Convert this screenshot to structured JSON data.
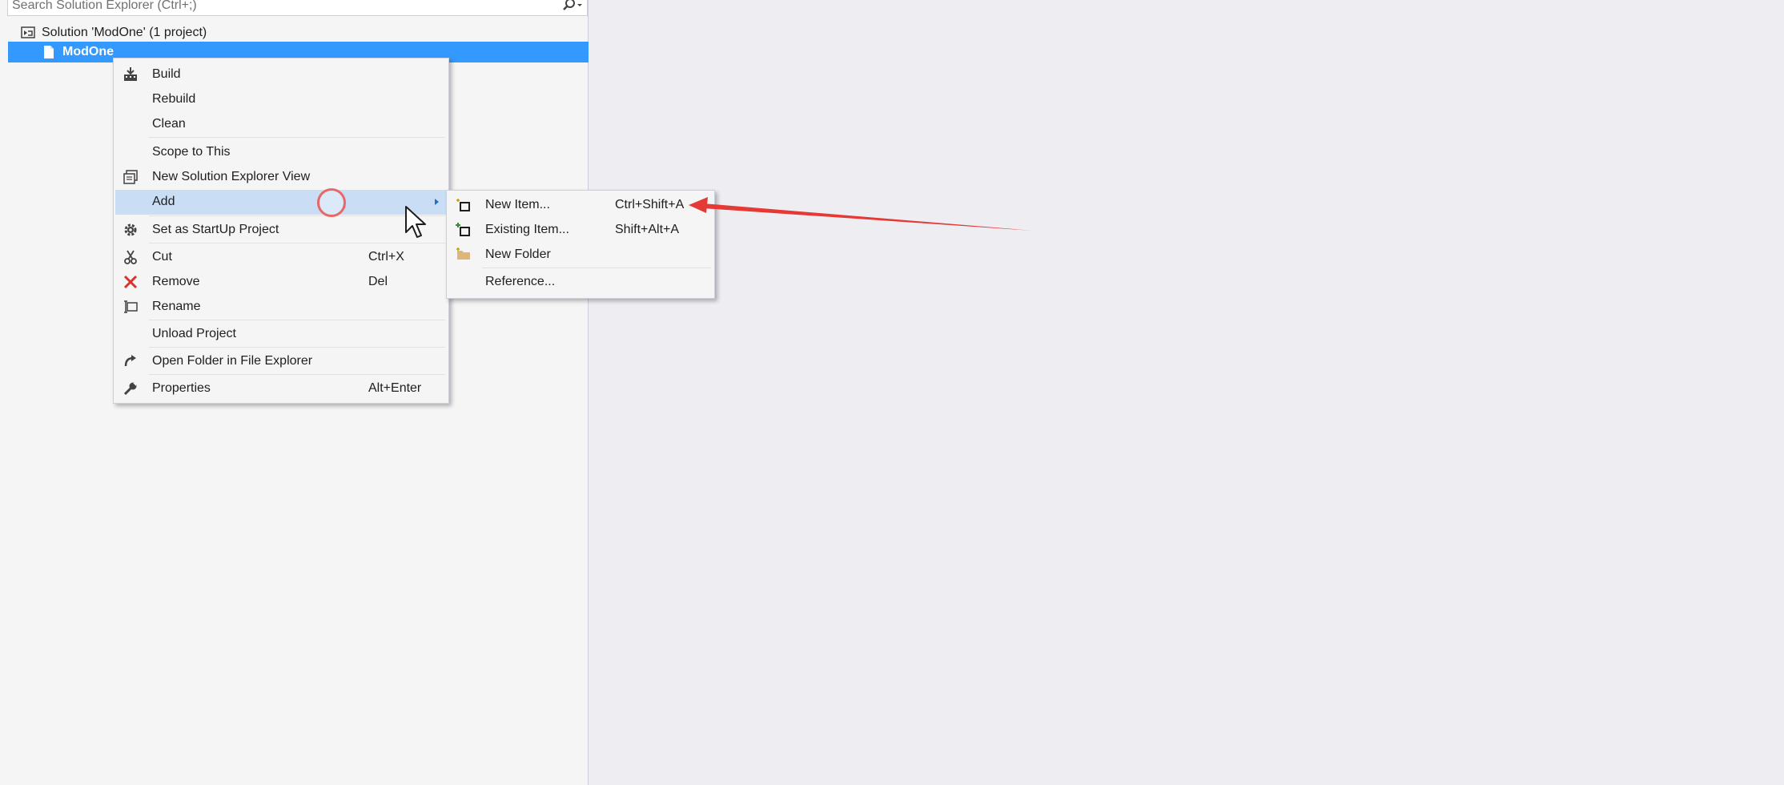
{
  "search": {
    "placeholder": "Search Solution Explorer (Ctrl+;)",
    "icon": "search-icon"
  },
  "tree": {
    "solution_label": "Solution 'ModOne' (1 project)",
    "project_label": "ModOne"
  },
  "context_menu": {
    "items": [
      {
        "label": "Build",
        "shortcut": "",
        "icon": "build-icon"
      },
      {
        "label": "Rebuild",
        "shortcut": ""
      },
      {
        "label": "Clean",
        "shortcut": ""
      },
      {
        "label": "Scope to This",
        "shortcut": ""
      },
      {
        "label": "New Solution Explorer View",
        "shortcut": "",
        "icon": "new-view-icon"
      },
      {
        "label": "Add",
        "shortcut": "",
        "has_submenu": true,
        "highlighted": true
      },
      {
        "label": "Set as StartUp Project",
        "shortcut": "",
        "icon": "gear-icon"
      },
      {
        "label": "Cut",
        "shortcut": "Ctrl+X",
        "icon": "scissors-icon"
      },
      {
        "label": "Remove",
        "shortcut": "Del",
        "icon": "red-x-icon"
      },
      {
        "label": "Rename",
        "shortcut": "",
        "icon": "rename-icon"
      },
      {
        "label": "Unload Project",
        "shortcut": ""
      },
      {
        "label": "Open Folder in File Explorer",
        "shortcut": "",
        "icon": "open-folder-arrow-icon"
      },
      {
        "label": "Properties",
        "shortcut": "Alt+Enter",
        "icon": "wrench-icon"
      }
    ]
  },
  "add_submenu": {
    "items": [
      {
        "label": "New Item...",
        "shortcut": "Ctrl+Shift+A",
        "icon": "new-item-icon"
      },
      {
        "label": "Existing Item...",
        "shortcut": "Shift+Alt+A",
        "icon": "existing-item-icon"
      },
      {
        "label": "New Folder",
        "shortcut": "",
        "icon": "folder-icon"
      },
      {
        "label": "Reference...",
        "shortcut": ""
      }
    ]
  },
  "colors": {
    "selection": "#3399ff",
    "menu_highlight": "#c9def5",
    "annotation_arrow": "#e53935",
    "remove_icon": "#d9312c"
  }
}
